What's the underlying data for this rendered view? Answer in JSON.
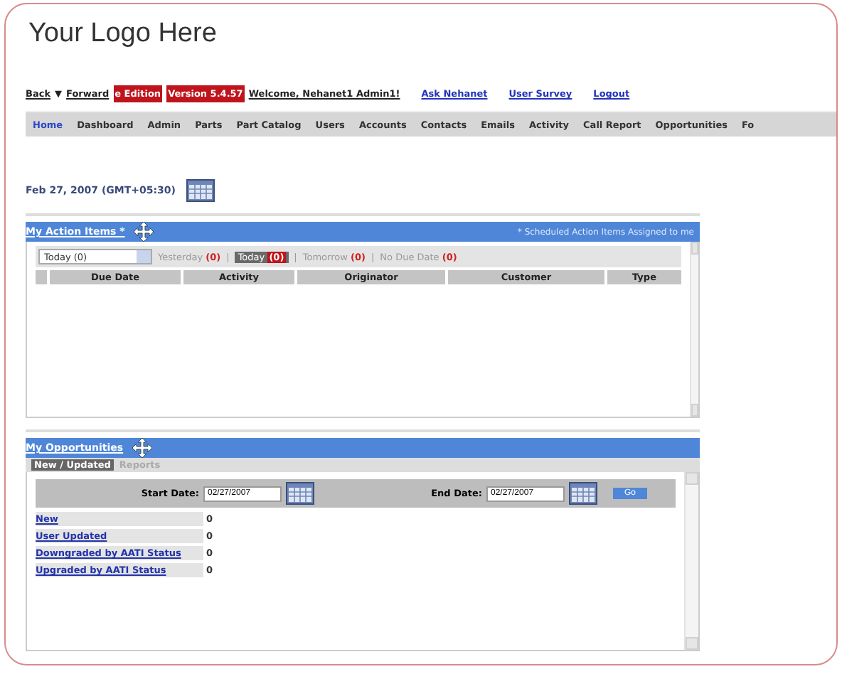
{
  "logo": "Your Logo Here",
  "top_links": [
    {
      "label": "Back",
      "kind": "link"
    },
    {
      "label": "▼",
      "kind": "plain"
    },
    {
      "label": "Forward",
      "kind": "link"
    },
    {
      "label": "e Edition",
      "kind": "badge"
    },
    {
      "label": "Version 5.4.57",
      "kind": "badge"
    },
    {
      "label": "Welcome, Nehanet1 Admin1!",
      "kind": "link"
    },
    {
      "label": "Ask Nehanet",
      "kind": "blue"
    },
    {
      "label": "User Survey",
      "kind": "blue"
    },
    {
      "label": "Logout",
      "kind": "blue"
    }
  ],
  "tabs": [
    {
      "label": "Home",
      "selected": true
    },
    {
      "label": "Dashboard",
      "selected": false
    },
    {
      "label": "Admin",
      "selected": false
    },
    {
      "label": "Parts",
      "selected": false
    },
    {
      "label": "Part Catalog",
      "selected": false
    },
    {
      "label": "Users",
      "selected": false
    },
    {
      "label": "Accounts",
      "selected": false
    },
    {
      "label": "Contacts",
      "selected": false
    },
    {
      "label": "Emails",
      "selected": false
    },
    {
      "label": "Activity",
      "selected": false
    },
    {
      "label": "Call Report",
      "selected": false
    },
    {
      "label": "Opportunities",
      "selected": false
    },
    {
      "label": "Fo",
      "selected": false
    }
  ],
  "date": "Feb 27, 2007 (GMT+05:30)",
  "action_items": {
    "title": "My Action Items *",
    "note": "* Scheduled Action Items Assigned to me",
    "select": "Today (0)",
    "separators": [
      "|",
      "|",
      "|"
    ],
    "filters": [
      {
        "label": "Yesterday",
        "count": "(0)",
        "selected": false
      },
      {
        "label": "Today",
        "count": "(0)",
        "selected": true
      },
      {
        "label": "Tomorrow",
        "count": "(0)",
        "selected": false
      },
      {
        "label": "No Due Date",
        "count": "(0)",
        "selected": false
      }
    ],
    "columns": [
      "Due Date",
      "Activity",
      "Originator",
      "Customer",
      "Type"
    ]
  },
  "opportunities": {
    "title": "My Opportunities",
    "tabs": [
      {
        "label": "New / Updated",
        "selected": true
      },
      {
        "label": "Reports",
        "selected": false
      }
    ],
    "start_label": "Start Date:",
    "start_value": "02/27/2007",
    "end_label": "End Date:",
    "end_value": "02/27/2007",
    "go": "Go",
    "rows": [
      {
        "label": "New",
        "value": "0"
      },
      {
        "label": "User Updated",
        "value": "0"
      },
      {
        "label": "Downgraded by AATI Status",
        "value": "0"
      },
      {
        "label": "Upgraded by AATI Status",
        "value": "0"
      }
    ]
  }
}
